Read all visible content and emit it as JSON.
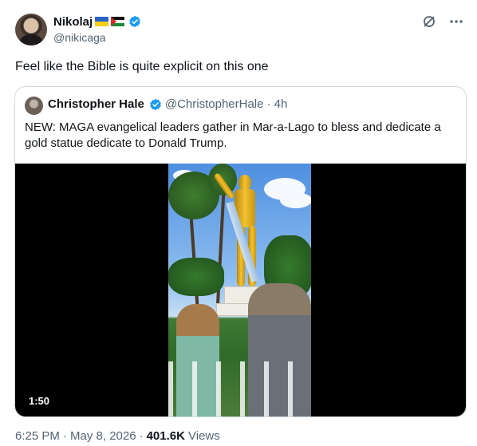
{
  "tweet": {
    "author": {
      "name": "Nikolaj",
      "handle": "@nikicaga",
      "flags": [
        "ukraine-flag",
        "palestine-flag"
      ],
      "verified": true
    },
    "text": "Feel like the Bible is quite explicit on this one",
    "icons": [
      "grok-icon",
      "more-icon"
    ]
  },
  "quote": {
    "author": {
      "name": "Christopher Hale",
      "handle": "@ChristopherHale",
      "time": "· 4h",
      "verified": true
    },
    "text": "NEW: MAGA evangelical leaders gather in Mar-a-Lago to bless and dedicate a gold statue dedicate to Donald Trump.",
    "video": {
      "duration": "1:50"
    }
  },
  "meta": {
    "time": "6:25 PM",
    "date": "· May 8, 2026",
    "sep": "·",
    "views": "401.6K",
    "views_label": "Views"
  },
  "colors": {
    "verified": "#1d9bf0",
    "secondary_text": "#536471",
    "border": "#cfd9de"
  }
}
